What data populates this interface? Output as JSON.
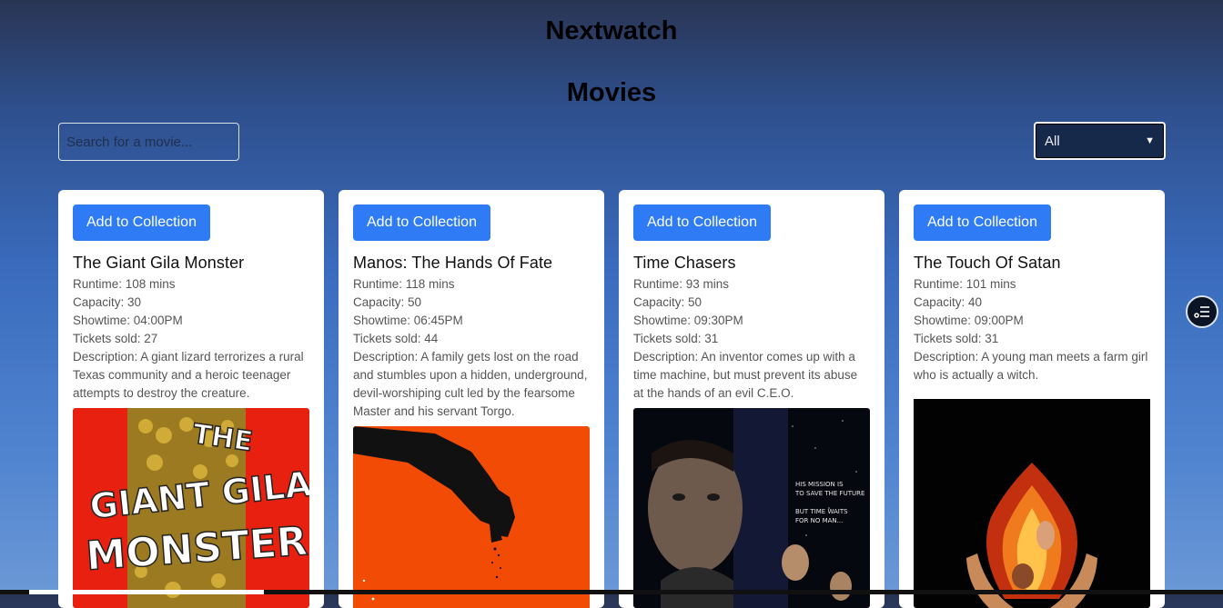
{
  "header": {
    "site_title": "Nextwatch",
    "page_title": "Movies"
  },
  "search": {
    "placeholder": "Search for a movie...",
    "value": ""
  },
  "filter": {
    "selected": "All"
  },
  "labels": {
    "add_button": "Add to Collection"
  },
  "movies": [
    {
      "title": "The Giant Gila Monster",
      "runtime": "Runtime: 108 mins",
      "capacity": "Capacity: 30",
      "showtime": "Showtime: 04:00PM",
      "tickets": "Tickets sold: 27",
      "description": "Description: A giant lizard terrorizes a rural Texas community and a heroic teenager attempts to destroy the creature.",
      "poster_text": [
        "THE",
        "GIANT GILA",
        "MONSTER"
      ]
    },
    {
      "title": "Manos: The Hands Of Fate",
      "runtime": "Runtime: 118 mins",
      "capacity": "Capacity: 50",
      "showtime": "Showtime: 06:45PM",
      "tickets": "Tickets sold: 44",
      "description": "Description: A family gets lost on the road and stumbles upon a hidden, underground, devil-worshiping cult led by the fearsome Master and his servant Torgo."
    },
    {
      "title": "Time Chasers",
      "runtime": "Runtime: 93 mins",
      "capacity": "Capacity: 50",
      "showtime": "Showtime: 09:30PM",
      "tickets": "Tickets sold: 31",
      "description": "Description: An inventor comes up with a time machine, but must prevent its abuse at the hands of an evil C.E.O.",
      "poster_text": [
        "HIS MISSION IS",
        "TO SAVE THE FUTURE",
        "BUT TIME WAITS",
        "FOR NO MAN..."
      ]
    },
    {
      "title": "The Touch Of Satan",
      "runtime": "Runtime: 101 mins",
      "capacity": "Capacity: 40",
      "showtime": "Showtime: 09:00PM",
      "tickets": "Tickets sold: 31",
      "description": "Description: A young man meets a farm girl who is actually a witch."
    }
  ],
  "colors": {
    "button": "#2f7bf6",
    "card": "#ffffff"
  }
}
